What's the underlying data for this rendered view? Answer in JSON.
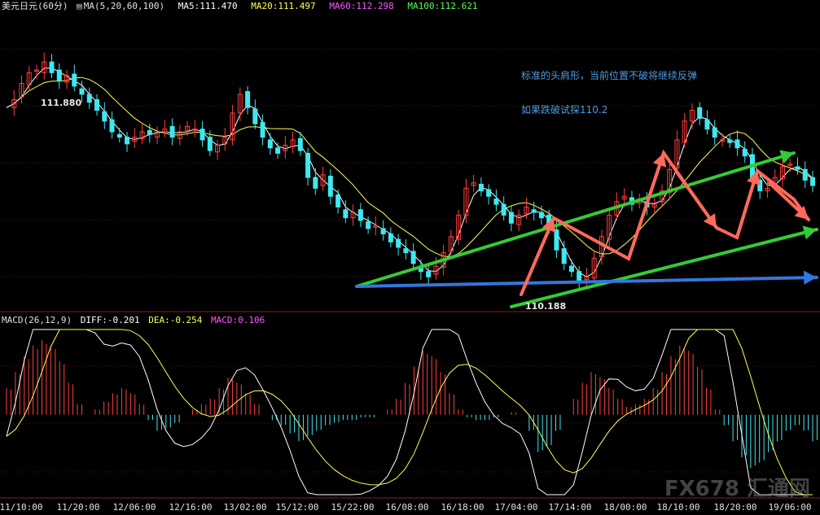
{
  "header": {
    "symbol": "美元日元",
    "period": "(60分)",
    "ma_spec": "MA(5,20,60,100)",
    "ma5": "MA5:111.470",
    "ma20": "MA20:111.497",
    "ma60": "MA60:112.298",
    "ma100": "MA100:112.621"
  },
  "macd_header": {
    "spec": "MACD(26,12,9)",
    "diff": "DIFF:-0.201",
    "dea": "DEA:-0.254",
    "macd": "MACD:0.106"
  },
  "annotations": {
    "note1": "标准的头肩形，当前位置不破将继续反弹",
    "note2": "如果跌破试探110.2",
    "high_label": "111.880",
    "low_label": "110.188"
  },
  "watermark": "FX678 汇通网",
  "colors": {
    "ma5": "#ffffff",
    "ma20": "#ffff55",
    "ma60": "#ff55ff",
    "ma100": "#55ff55",
    "up_candle": "#ff4040",
    "down_candle": "#3ee8f0",
    "arrow_green": "#33cc33",
    "arrow_blue": "#3377dd",
    "arrow_red": "#ff6a5a"
  },
  "chart_data": {
    "type": "candlestick",
    "x_tick_labels": [
      "11/10:00",
      "11/20:00",
      "12/06:00",
      "12/16:00",
      "13/02:00",
      "15/12:00",
      "15/22:00",
      "16/08:00",
      "16/18:00",
      "17/04:00",
      "17/14:00",
      "18/00:00",
      "18/10:00",
      "18/20:00",
      "19/06:00"
    ],
    "price_high": 111.88,
    "price_low": 110.188,
    "closes_approx": [
      111.52,
      111.58,
      111.7,
      111.78,
      111.8,
      111.86,
      111.78,
      111.72,
      111.76,
      111.68,
      111.62,
      111.56,
      111.5,
      111.42,
      111.34,
      111.3,
      111.25,
      111.3,
      111.34,
      111.32,
      111.34,
      111.36,
      111.3,
      111.34,
      111.38,
      111.36,
      111.28,
      111.2,
      111.24,
      111.3,
      111.48,
      111.62,
      111.52,
      111.4,
      111.3,
      111.22,
      111.18,
      111.24,
      111.28,
      111.2,
      111.0,
      110.92,
      111.02,
      110.86,
      110.78,
      110.7,
      110.74,
      110.68,
      110.62,
      110.64,
      110.58,
      110.52,
      110.48,
      110.44,
      110.36,
      110.3,
      110.26,
      110.34,
      110.44,
      110.56,
      110.72,
      110.92,
      110.96,
      110.9,
      110.86,
      110.8,
      110.72,
      110.66,
      110.72,
      110.78,
      110.74,
      110.7,
      110.62,
      110.46,
      110.36,
      110.3,
      110.22,
      110.26,
      110.4,
      110.56,
      110.72,
      110.82,
      110.86,
      110.8,
      110.84,
      110.78,
      110.8,
      110.9,
      111.06,
      111.28,
      111.42,
      111.5,
      111.44,
      111.36,
      111.3,
      111.28,
      111.26,
      111.22,
      111.16,
      111.0,
      110.9,
      110.92,
      111.0,
      111.08,
      111.1,
      111.06,
      110.98,
      110.94
    ],
    "macd_histogram_approx": [
      0.1,
      0.16,
      0.22,
      0.26,
      0.28,
      0.26,
      0.2,
      0.12,
      0.04,
      0.0,
      0.02,
      0.05,
      0.08,
      0.1,
      0.08,
      0.04,
      -0.02,
      -0.06,
      -0.05,
      -0.03,
      0.0,
      0.02,
      0.04,
      0.06,
      0.1,
      0.14,
      0.12,
      0.08,
      0.04,
      0.0,
      -0.02,
      -0.04,
      -0.07,
      -0.1,
      -0.08,
      -0.06,
      -0.04,
      -0.03,
      -0.02,
      -0.02,
      -0.01,
      -0.01,
      0.0,
      0.02,
      0.06,
      0.12,
      0.18,
      0.24,
      0.22,
      0.16,
      0.08,
      0.02,
      -0.01,
      -0.02,
      -0.02,
      -0.01,
      0.0,
      0.01,
      0.0,
      -0.06,
      -0.14,
      -0.12,
      -0.06,
      0.0,
      0.06,
      0.12,
      0.16,
      0.14,
      0.1,
      0.06,
      0.03,
      0.04,
      0.06,
      0.1,
      0.16,
      0.22,
      0.26,
      0.24,
      0.18,
      0.1,
      0.02,
      -0.04,
      -0.1,
      -0.16,
      -0.2,
      -0.18,
      -0.14,
      -0.1,
      -0.06,
      -0.04,
      -0.06,
      -0.1
    ],
    "macd_range": [
      -0.3,
      0.32
    ]
  }
}
